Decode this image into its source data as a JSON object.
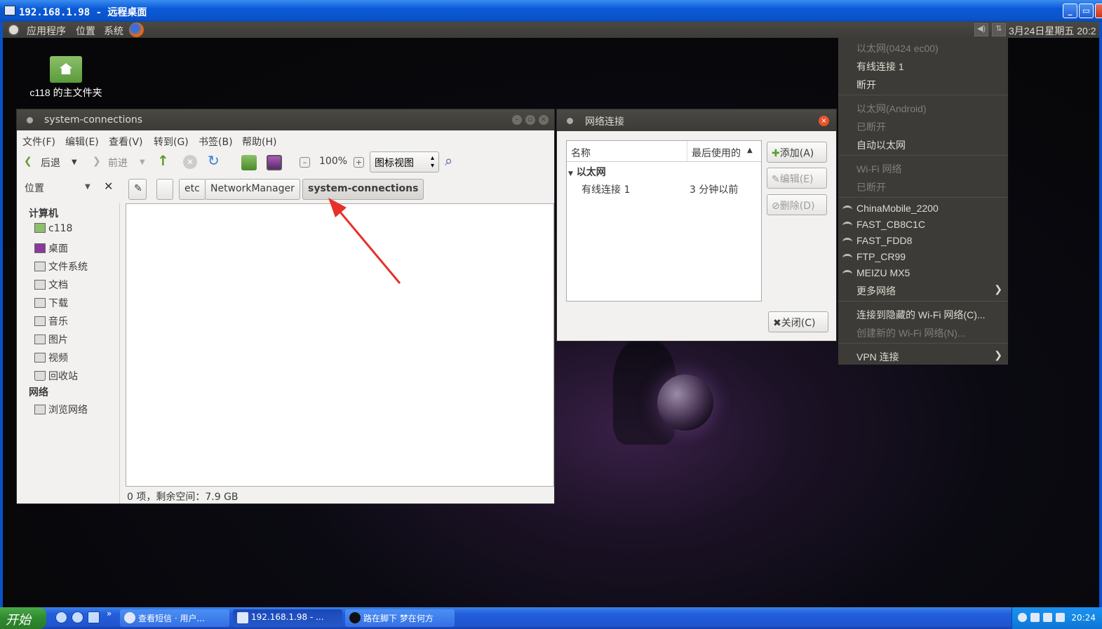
{
  "rdp": {
    "title": "192.168.1.98 - 远程桌面"
  },
  "panel": {
    "menus": [
      "应用程序",
      "位置",
      "系统"
    ],
    "clock": "3月24日星期五 20:2"
  },
  "desktop": {
    "home_icon_label": "c118 的主文件夹"
  },
  "file_manager": {
    "title": "system-connections",
    "menu": [
      "文件(F)",
      "编辑(E)",
      "查看(V)",
      "转到(G)",
      "书签(B)",
      "帮助(H)"
    ],
    "back_label": "后退",
    "forward_label": "前进",
    "zoom": "100%",
    "view_mode": "图标视图",
    "places_label": "位置",
    "breadcrumbs": [
      "etc",
      "NetworkManager",
      "system-connections"
    ],
    "sidebar": {
      "computer_heading": "计算机",
      "computer_items": [
        "c118",
        "桌面",
        "文件系统",
        "文档",
        "下载",
        "音乐",
        "图片",
        "视频",
        "回收站"
      ],
      "network_heading": "网络",
      "network_items": [
        "浏览网络"
      ]
    },
    "status": "0 项，剩余空间：7.9 GB"
  },
  "network_dialog": {
    "title": "网络连接",
    "col_name": "名称",
    "col_last_used": "最后使用的",
    "group": "以太网",
    "connection_name": "有线连接 1",
    "connection_last_used": "3 分钟以前",
    "add": "添加(A)",
    "edit": "编辑(E)",
    "delete": "删除(D)",
    "close": "关闭(C)"
  },
  "nm_menu": {
    "eth1_header": "以太网(0424 ec00)",
    "eth1_conn": "有线连接 1",
    "eth1_disconnect": "断开",
    "eth2_header": "以太网(Android)",
    "eth2_status": "已断开",
    "eth2_auto": "自动以太网",
    "wifi_header": "Wi-Fi 网络",
    "wifi_status": "已断开",
    "networks": [
      "ChinaMobile_2200",
      "FAST_CB8C1C",
      "FAST_FDD8",
      "FTP_CR99",
      "MEIZU MX5"
    ],
    "more": "更多网络",
    "hidden": "连接到隐藏的 Wi-Fi 网络(C)...",
    "create": "创建新的 Wi-Fi 网络(N)...",
    "vpn": "VPN 连接"
  },
  "taskbar": {
    "start": "开始",
    "tasks": [
      "查看短信 · 用户...",
      "192.168.1.98 - ...",
      "路在脚下  梦在何方"
    ],
    "clock": "20:24"
  }
}
